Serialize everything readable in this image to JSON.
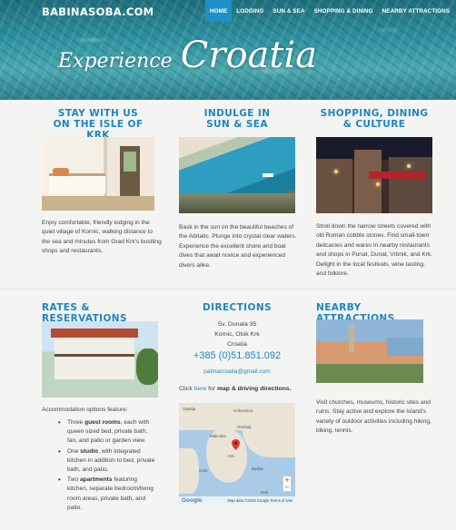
{
  "brand": "BABINASOBA.COM",
  "nav": [
    "HOME",
    "LODGING",
    "SUN & SEA",
    "SHOPPING & DINING",
    "NEARBY ATTRACTIONS"
  ],
  "hero": {
    "small": "Experience",
    "big": "Croatia"
  },
  "stay": {
    "title1": "STAY WITH US",
    "title2": "ON THE ISLE OF KRK",
    "text": "Enjoy comfortable, friendly lodging in the quiet village of Kornic, walking distance to the sea and minutes from Grad Krk's bustling shops and restaurants."
  },
  "indulge": {
    "title1": "INDULGE IN",
    "title2": "SUN & SEA",
    "text": "Bask in the sun on the beautiful beaches of the Adriatic. Plunge into crystal clear waters. Experience the excellent shore and boat dives that await novice and experienced divers alike."
  },
  "shopping": {
    "title1": "SHOPPING, DINING",
    "title2": "& CULTURE",
    "text": "Stroll down the narrow streets covered with old Roman cobble stones. Find small-town delicacies and wares in nearby restaurants and shops in Punat, Dunat, Vrbnik, and Krk. Delight in the local festivals, wine tasting, and folklore."
  },
  "rates": {
    "title": "RATES & RESERVATIONS",
    "intro": "Accommodation options feature:",
    "items": [
      {
        "pre": "Three ",
        "bold": "guest rooms",
        "post": ", each with queen sized bed, private bath, fan, and patio or garden view."
      },
      {
        "pre": "One ",
        "bold": "studio",
        "post": ", with integrated kitchen in addition to bed, private bath, and patio."
      },
      {
        "pre": "Two ",
        "bold": "apartments",
        "post": " featuring kitchen, separate bedroom/living room areas, private bath, and patio."
      }
    ]
  },
  "directions": {
    "title": "DIRECTIONS",
    "address1": "Sv. Dunata 35",
    "address2": "Kornic, Otok Krk",
    "address3": "Croatia",
    "phone": "+385 (0)51.851.092",
    "email": "palmacroatia@gmail.com",
    "click": "Click ",
    "here": "here",
    "for": " for ",
    "map_link": "map & driving directions.",
    "map_labels": [
      "Crikvenica",
      "Malinska",
      "Krk",
      "Baška",
      "Rab",
      "Cres",
      "Omišalj",
      "Opatija"
    ],
    "map_google": "Google",
    "map_credit": "Map data ©2018 Google   Terms of Use"
  },
  "nearby": {
    "title": "NEARBY ATTRACTIONS",
    "text": "Visit churches, museums, historic sites and ruins. Stay active and explore the island's variety of outdoor activities including hiking, biking, tennis."
  },
  "colors": {
    "accent": "#1c86c1",
    "nav_active": "#1c90c9"
  }
}
